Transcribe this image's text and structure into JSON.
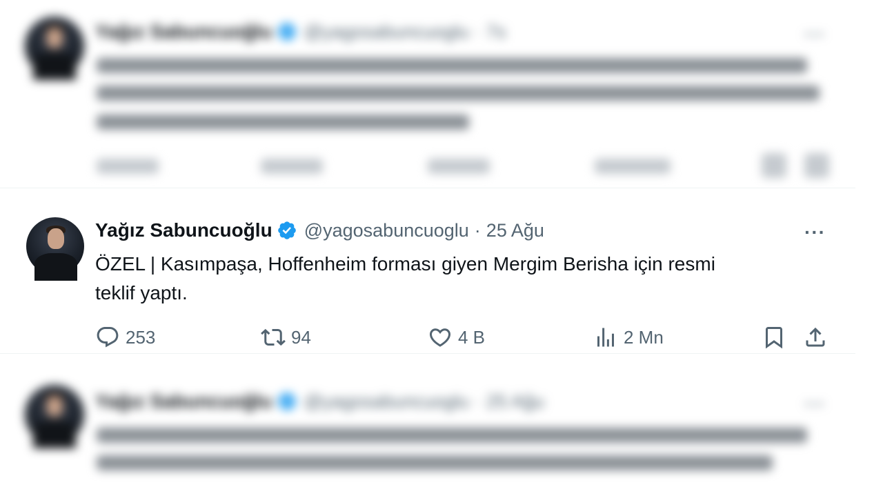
{
  "top_tweet": {
    "name": "Yağız Sabuncuoğlu",
    "handle": "@yagosabuncuoglu",
    "date": "7s"
  },
  "main_tweet": {
    "name": "Yağız Sabuncuoğlu",
    "handle": "@yagosabuncuoglu",
    "date": "25 Ağu",
    "text_line1": "ÖZEL | Kasımpaşa, Hoffenheim forması giyen Mergim Berisha için resmi",
    "text_line2": "teklif yaptı.",
    "more_label": "···",
    "replies": "253",
    "retweets": "94",
    "likes": "4 B",
    "views": "2 Mn"
  },
  "bottom_tweet": {
    "name": "Yağız Sabuncuoğlu",
    "handle": "@yagosabuncuoglu",
    "date": "25 Ağu"
  },
  "colors": {
    "verified": "#1d9bf0",
    "text_primary": "#0f1419",
    "text_secondary": "#536471"
  },
  "icons": [
    "reply-icon",
    "retweet-icon",
    "like-icon",
    "views-icon",
    "bookmark-icon",
    "share-icon",
    "verified-badge-icon",
    "more-icon"
  ]
}
